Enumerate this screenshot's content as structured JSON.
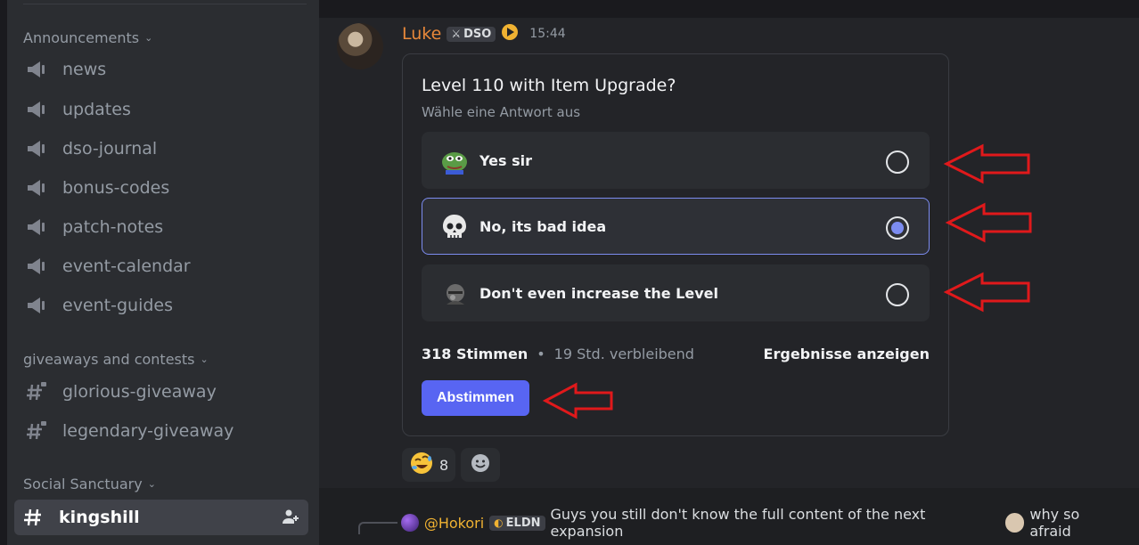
{
  "sidebar": {
    "categories": [
      {
        "label": "Announcements"
      },
      {
        "label": "giveaways and contests"
      },
      {
        "label": "Social Sanctuary"
      }
    ],
    "channels": [
      {
        "label": "news",
        "icon": "megaphone-icon"
      },
      {
        "label": "updates",
        "icon": "megaphone-icon"
      },
      {
        "label": "dso-journal",
        "icon": "megaphone-icon"
      },
      {
        "label": "bonus-codes",
        "icon": "megaphone-icon"
      },
      {
        "label": "patch-notes",
        "icon": "megaphone-icon"
      },
      {
        "label": "event-calendar",
        "icon": "megaphone-icon"
      },
      {
        "label": "event-guides",
        "icon": "megaphone-icon"
      },
      {
        "label": "glorious-giveaway",
        "icon": "locked-hash-icon"
      },
      {
        "label": "legendary-giveaway",
        "icon": "locked-hash-icon"
      },
      {
        "label": "kingshill",
        "icon": "hash-icon",
        "active": true
      }
    ]
  },
  "message": {
    "author": "Luke",
    "author_color": "#e8883a",
    "tag": "DSO",
    "time": "15:44"
  },
  "poll": {
    "question": "Level 110 with Item Upgrade?",
    "subtitle": "Wähle eine Antwort aus",
    "options": [
      {
        "label": "Yes sir",
        "emoji": "pepe-emoji",
        "selected": false
      },
      {
        "label": "No, its bad idea",
        "emoji": "skull-emoji",
        "selected": true
      },
      {
        "label": "Don't even increase the Level",
        "emoji": "knight-emoji",
        "selected": false
      }
    ],
    "votes": "318 Stimmen",
    "remaining": "19 Std. verbleibend",
    "results_label": "Ergebnisse anzeigen",
    "vote_button": "Abstimmen",
    "accent": "#5865f2"
  },
  "reactions": [
    {
      "emoji": "rofl-emoji",
      "count": "8"
    }
  ],
  "reply": {
    "mention": "@Hokori",
    "tag": "ELDN",
    "text": "Guys you still don't know the full content of the next expansion",
    "text2": "why so afraid"
  },
  "annotation_color": "#e0191b"
}
